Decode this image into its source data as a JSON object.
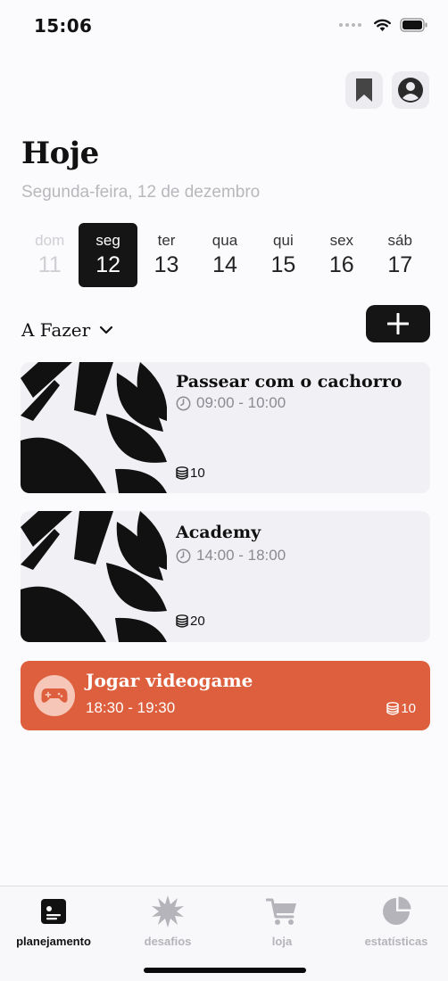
{
  "status_bar": {
    "time": "15:06"
  },
  "header": {
    "title": "Hoje",
    "subtitle": "Segunda-feira, 12 de dezembro"
  },
  "week": [
    {
      "name": "dom",
      "num": "11",
      "state": "past"
    },
    {
      "name": "seg",
      "num": "12",
      "state": "selected"
    },
    {
      "name": "ter",
      "num": "13",
      "state": "normal"
    },
    {
      "name": "qua",
      "num": "14",
      "state": "normal"
    },
    {
      "name": "qui",
      "num": "15",
      "state": "normal"
    },
    {
      "name": "sex",
      "num": "16",
      "state": "normal"
    },
    {
      "name": "sáb",
      "num": "17",
      "state": "normal"
    }
  ],
  "section": {
    "label": "A Fazer"
  },
  "tasks": [
    {
      "title": "Passear com o cachorro",
      "time": "09:00 - 10:00",
      "coins": "10"
    },
    {
      "title": "Academy",
      "time": "14:00 - 18:00",
      "coins": "20"
    }
  ],
  "highlight_task": {
    "title": "Jogar videogame",
    "time": "18:30 - 19:30",
    "coins": "10",
    "icon": "gamepad-icon",
    "color": "#dd5f3d"
  },
  "tab_bar": {
    "tabs": [
      {
        "label": "planejamento",
        "icon": "planner-icon",
        "active": true
      },
      {
        "label": "desafios",
        "icon": "starburst-icon",
        "active": false
      },
      {
        "label": "loja",
        "icon": "cart-icon",
        "active": false
      },
      {
        "label": "estatísticas",
        "icon": "pie-chart-icon",
        "active": false
      }
    ]
  },
  "colors": {
    "accent": "#151515",
    "highlight": "#dd5f3d",
    "muted": "#b8b8bc"
  }
}
